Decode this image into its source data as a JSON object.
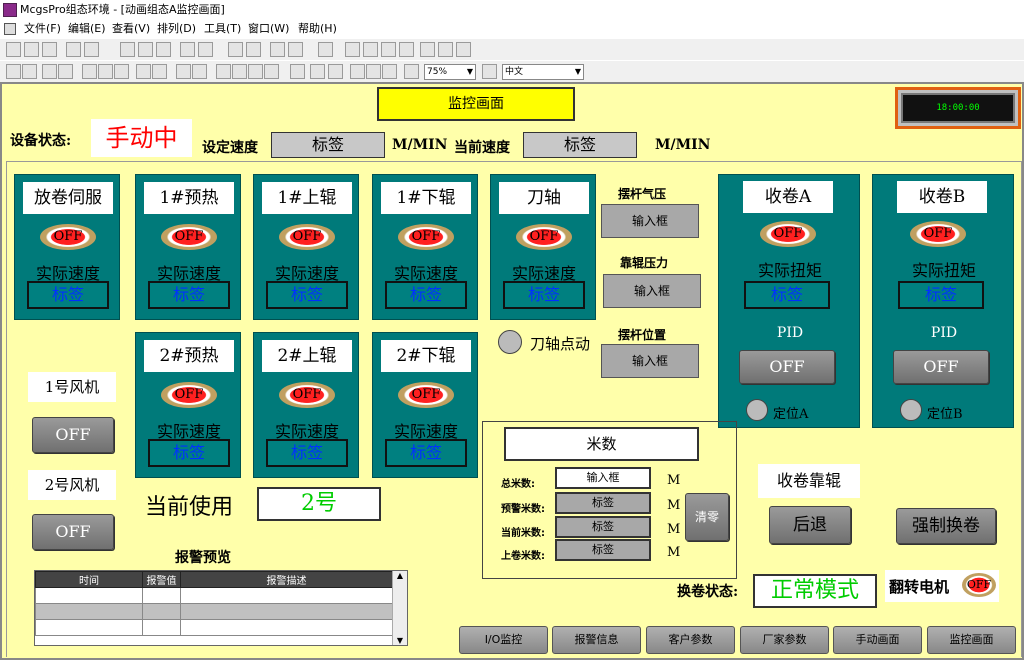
{
  "titlebar": {
    "title": "McgsPro组态环境 - [动画组态A监控画面]"
  },
  "menubar": {
    "items": [
      "文件(F)",
      "编辑(E)",
      "查看(V)",
      "排列(D)",
      "工具(T)",
      "窗口(W)",
      "帮助(H)"
    ]
  },
  "toolbar": {
    "zoom": "75%",
    "language": "中文"
  },
  "screen": {
    "title": "监控画面",
    "clock": "18:00:00"
  },
  "status": {
    "label": "设备状态:",
    "mode": "手动中",
    "set_speed_label": "设定速度",
    "set_speed_value": "标签",
    "unit1": "M/MIN",
    "cur_speed_label": "当前速度",
    "cur_speed_value": "标签",
    "unit2": "M/MIN"
  },
  "panels": [
    {
      "title": "放卷伺服",
      "lamp": "OFF",
      "speed_label": "实际速度",
      "value": "标签"
    },
    {
      "title": "1#预热",
      "lamp": "OFF",
      "speed_label": "实际速度",
      "value": "标签"
    },
    {
      "title": "1#上辊",
      "lamp": "OFF",
      "speed_label": "实际速度",
      "value": "标签"
    },
    {
      "title": "1#下辊",
      "lamp": "OFF",
      "speed_label": "实际速度",
      "value": "标签"
    },
    {
      "title": "刀轴",
      "lamp": "OFF",
      "speed_label": "实际速度",
      "value": "标签"
    },
    {
      "title": "2#预热",
      "lamp": "OFF",
      "speed_label": "实际速度",
      "value": "标签"
    },
    {
      "title": "2#上辊",
      "lamp": "OFF",
      "speed_label": "实际速度",
      "value": "标签"
    },
    {
      "title": "2#下辊",
      "lamp": "OFF",
      "speed_label": "实际速度",
      "value": "标签"
    }
  ],
  "pressure": {
    "swing_air_label": "摆杆气压",
    "swing_air_value": "输入框",
    "roll_pressure_label": "靠辊压力",
    "roll_pressure_value": "输入框",
    "swing_pos_label": "摆杆位置",
    "swing_pos_value": "输入框"
  },
  "knife_jog": "刀轴点动",
  "winders": [
    {
      "title": "收卷A",
      "lamp": "OFF",
      "torque_label": "实际扭矩",
      "value": "标签",
      "pid_label": "PID",
      "pid_button": "OFF",
      "position": "定位A"
    },
    {
      "title": "收卷B",
      "lamp": "OFF",
      "torque_label": "实际扭矩",
      "value": "标签",
      "pid_label": "PID",
      "pid_button": "OFF",
      "position": "定位B"
    }
  ],
  "fans": {
    "fan1_label": "1号风机",
    "fan1_button": "OFF",
    "fan2_label": "2号风机",
    "fan2_button": "OFF"
  },
  "current_use": {
    "label": "当前使用",
    "value": "2号"
  },
  "meter": {
    "title": "米数",
    "rows": [
      {
        "label": "总米数:",
        "value": "输入框",
        "unit": "M"
      },
      {
        "label": "预警米数:",
        "value": "标签",
        "unit": "M"
      },
      {
        "label": "当前米数:",
        "value": "标签",
        "unit": "M"
      },
      {
        "label": "上卷米数:",
        "value": "标签",
        "unit": "M"
      }
    ],
    "clear": "清零"
  },
  "alarm": {
    "title": "报警预览",
    "headers": [
      "时间",
      "报警值",
      "报警描述"
    ]
  },
  "winding": {
    "roll_label": "收卷靠辊",
    "back_button": "后退",
    "force_button": "强制换卷",
    "change_label": "换卷状态:",
    "change_value": "正常模式",
    "flip_label": "翻转电机",
    "flip_lamp": "OFF"
  },
  "nav": [
    "I/O监控",
    "报警信息",
    "客户参数",
    "厂家参数",
    "手动画面",
    "监控画面"
  ],
  "colors": {
    "panel": "#007a7a",
    "background": "#ffffaa",
    "title_yellow": "#ffff00",
    "mode_red": "#ff0000",
    "green_text": "#00cc00"
  }
}
